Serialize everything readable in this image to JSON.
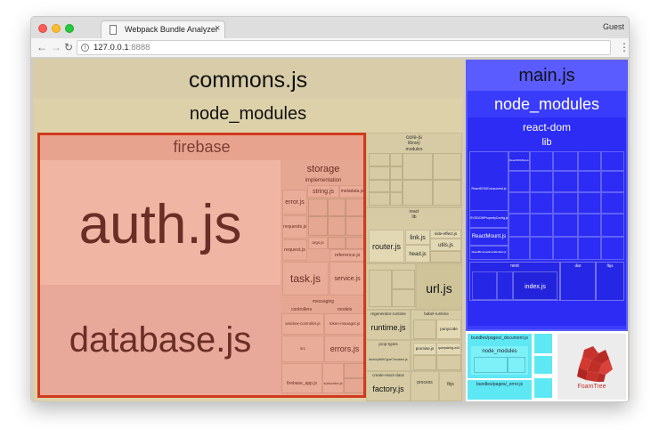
{
  "browser": {
    "tab_title": "Webpack Bundle Analyzer",
    "tab_close": "×",
    "profile": "Guest",
    "url_host": "127.0.0.1",
    "url_port": ":8888",
    "nav": {
      "back": "←",
      "forward": "→",
      "reload": "↻"
    },
    "menu": "⋮"
  },
  "colors": {
    "commons": "#d8cda8",
    "firebase": "#e8a38f",
    "firebase_border": "#d23a1c",
    "main": "#5a5cff",
    "react_dom": "#2c2cf5",
    "small_bundles": "#5ee8f4",
    "foamtree_red": "#c8322c"
  },
  "treemap": {
    "commons": {
      "name": "commons.js",
      "node_modules": "node_modules",
      "firebase": {
        "name": "firebase",
        "auth": "auth.js",
        "database": "database.js",
        "storage": "storage",
        "implementation": "implementation",
        "string": "string.js",
        "metadata": "metadata.js",
        "error": "error.js",
        "requests": "requests.js",
        "request": "request.js",
        "args": "args.js",
        "reference": "reference.js",
        "task": "task.js",
        "service": "service.js",
        "messaging": "messaging",
        "controllers": "controllers",
        "window_controller": "window-controller.js",
        "models": "models",
        "token_manager": "token-manager.js",
        "errors": "errors.js",
        "firebase_app": "firebase_app.js",
        "subscribe": "subscribe.js",
        "src": "src"
      },
      "core_js": {
        "name": "core-js",
        "library": "library",
        "modules": "modules"
      },
      "react": {
        "name": "react",
        "lib": "lib",
        "router": "router.js",
        "link": "link.js",
        "side_effect": "side-effect.js",
        "utils": "utils.js",
        "head": "head.js"
      },
      "url": "url.js",
      "regenerator": "regenerator-runtime",
      "runtime": "runtime.js",
      "babel_runtime": "babel-runtime",
      "punycode": "punycode",
      "prop_types": "prop-types",
      "promise": "promise.js",
      "querystring": "querystring-es3",
      "factory": "factory.js",
      "create_react_class": "create-react-class",
      "process": "process",
      "fbjs": "fbjs",
      "factory_with_type_checkers": "factoryWithTypeCheckers.js"
    },
    "main": {
      "name": "main.js",
      "node_modules": "node_modules",
      "react_dom": "react-dom",
      "lib": "lib",
      "react_dom_component": "ReactDOMComponent.js",
      "react_dom_input": "ReactDOMInput.js",
      "react_mount": "ReactMount.js",
      "dom_property_config": "SVGDOMPropertyConfig.js",
      "react_browser_event_emitter": "ReactBrowserEventEmitter.js",
      "next": "next",
      "index": "index.js",
      "dist": "dist",
      "fbjs": "fbjs"
    },
    "pages": {
      "document": "bundles/pages/_document.js",
      "node_modules": "node_modules",
      "error": "bundles/pages/_error.js"
    },
    "foamtree": "FoamTree"
  }
}
